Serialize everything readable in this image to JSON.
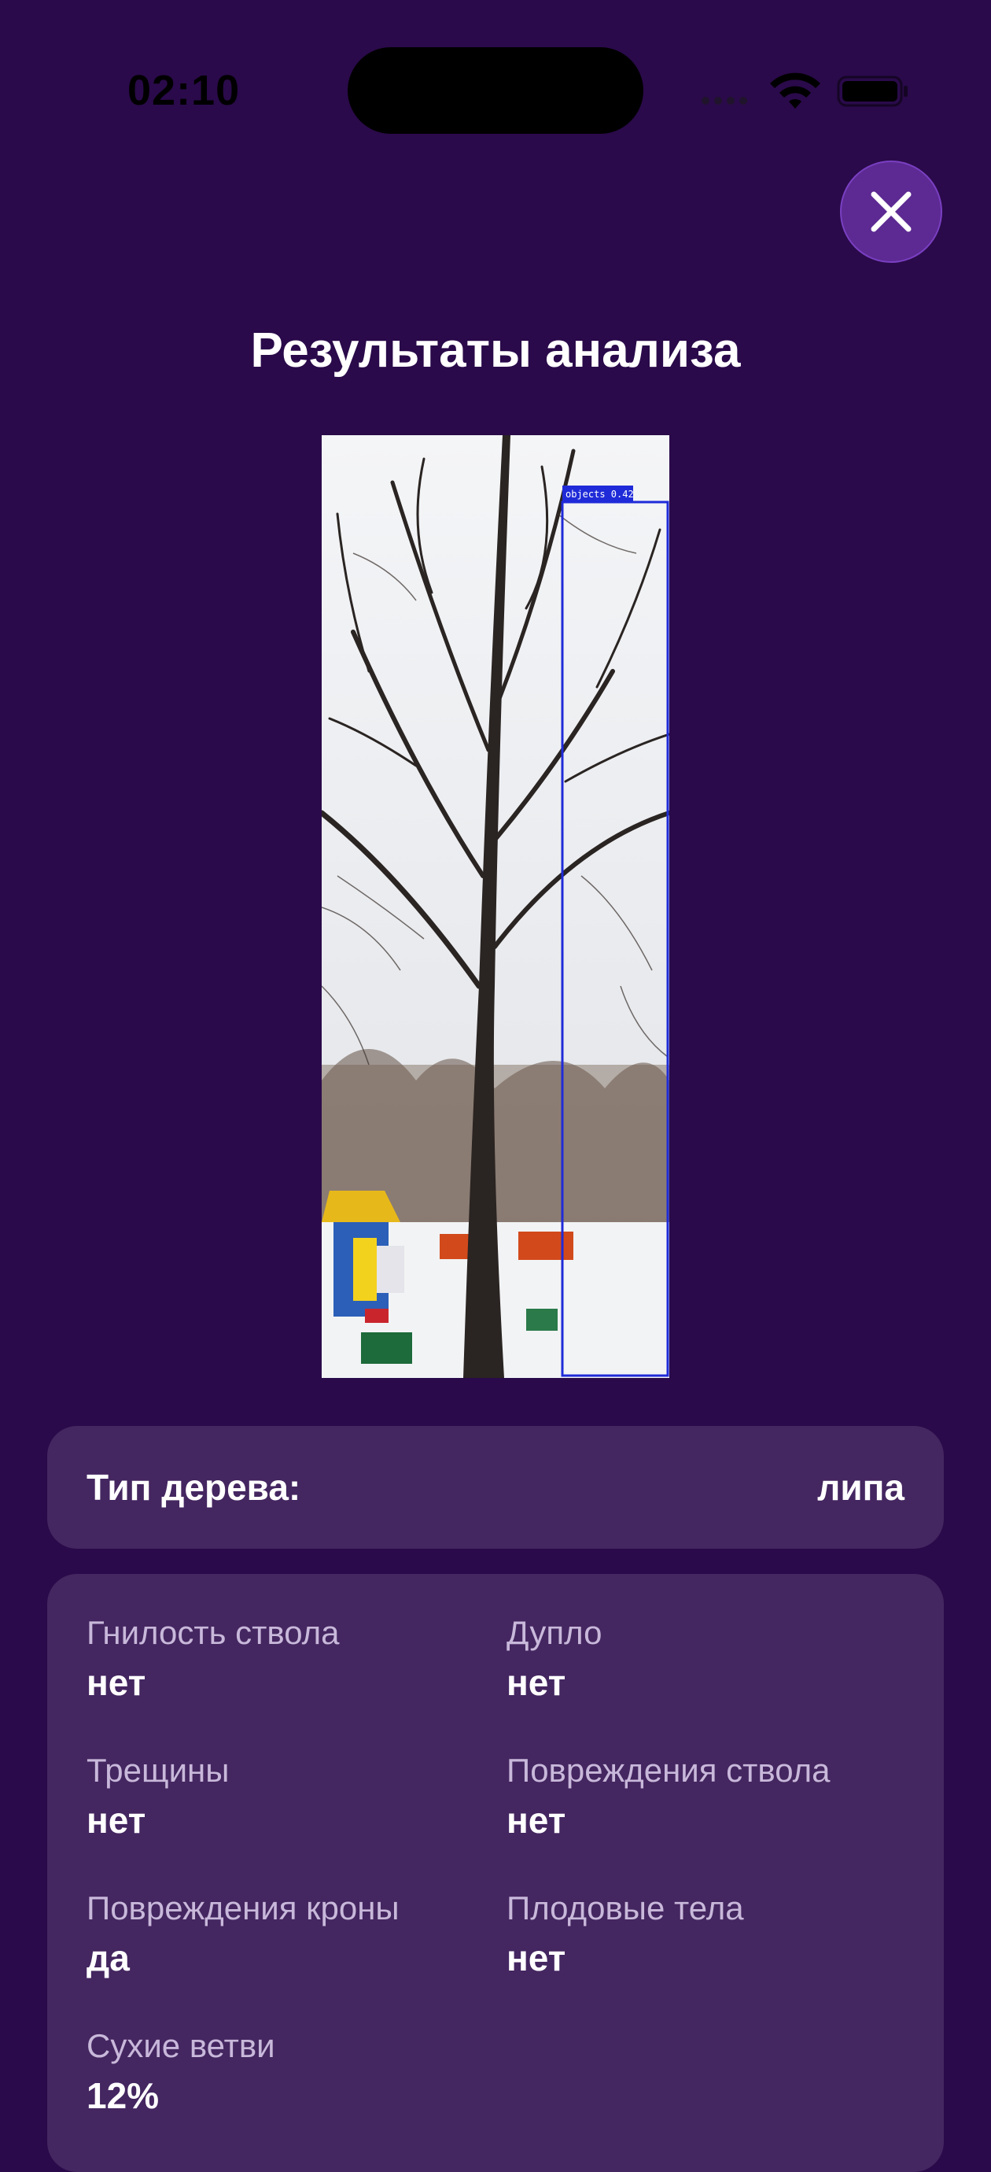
{
  "status_bar": {
    "time": "02:10"
  },
  "screen": {
    "title": "Результаты анализа"
  },
  "photo": {
    "detection_label": "objects 0.42"
  },
  "tree_type": {
    "label": "Тип дерева:",
    "value": "липа"
  },
  "findings": [
    {
      "label": "Гнилость ствола",
      "value": "нет"
    },
    {
      "label": "Дупло",
      "value": "нет"
    },
    {
      "label": "Трещины",
      "value": "нет"
    },
    {
      "label": "Повреждения ствола",
      "value": "нет"
    },
    {
      "label": "Повреждения кроны",
      "value": "да"
    },
    {
      "label": "Плодовые тела",
      "value": "нет"
    },
    {
      "label": "Сухие ветви",
      "value": "12%"
    }
  ],
  "colors": {
    "background": "#2a0a4a",
    "card": "#442660",
    "accent": "#5c2a92",
    "detection_box": "#1f2bd8"
  },
  "icons": [
    "wifi-icon",
    "battery-icon",
    "close-icon"
  ]
}
